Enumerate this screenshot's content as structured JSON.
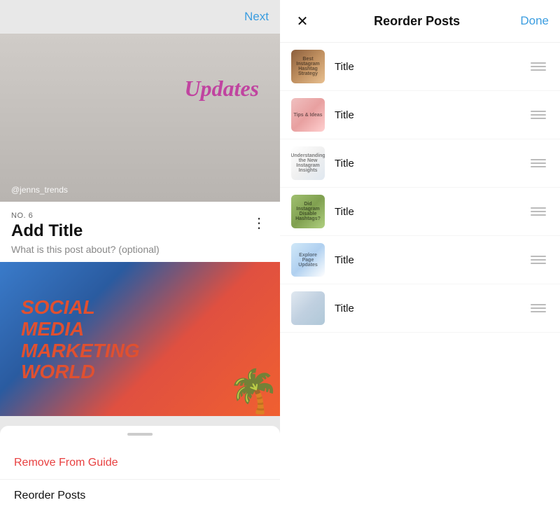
{
  "left_panel": {
    "next_button": "Next",
    "hero": {
      "updates_text": "Updates",
      "handle": "@jenns_trends"
    },
    "post_meta": {
      "number": "NO. 6",
      "title": "Add Title",
      "subtitle": "What is this post about? (optional)"
    },
    "bottom_sheet": {
      "remove_label": "Remove From Guide",
      "reorder_label": "Reorder Posts"
    }
  },
  "right_panel": {
    "title": "Reorder Posts",
    "done_button": "Done",
    "posts": [
      {
        "id": 1,
        "title": "Title",
        "thumb_class": "thumb-1"
      },
      {
        "id": 2,
        "title": "Title",
        "thumb_class": "thumb-2"
      },
      {
        "id": 3,
        "title": "Title",
        "thumb_class": "thumb-3"
      },
      {
        "id": 4,
        "title": "Title",
        "thumb_class": "thumb-4"
      },
      {
        "id": 5,
        "title": "Title",
        "thumb_class": "thumb-5"
      },
      {
        "id": 6,
        "title": "Title",
        "thumb_class": "thumb-6"
      }
    ]
  }
}
